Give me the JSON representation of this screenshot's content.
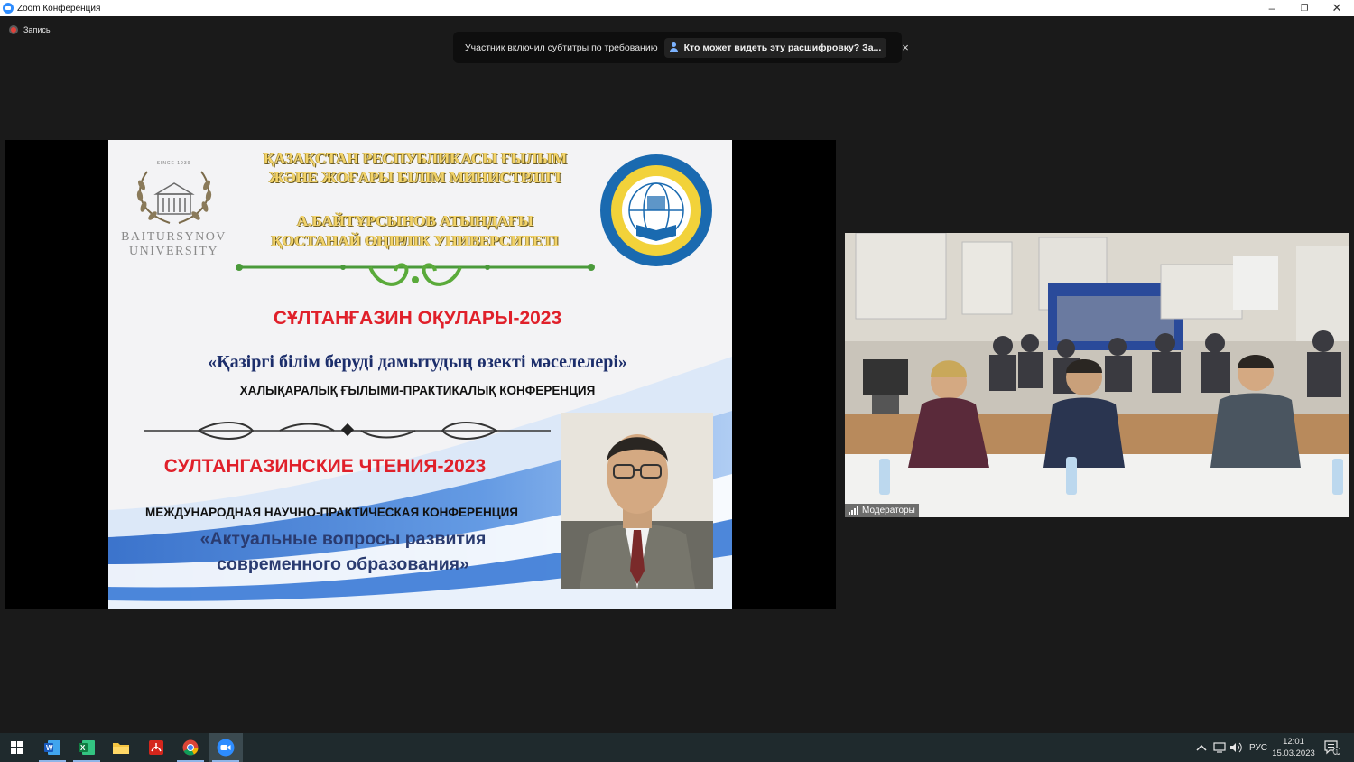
{
  "window": {
    "title": "Zoom Конференция",
    "controls": {
      "minimize": "–",
      "restore": "❐",
      "close": "✕"
    }
  },
  "recording": {
    "label": "Запись"
  },
  "notification": {
    "message": "Участник включил субтитры по требованию",
    "link": "Кто может видеть эту расшифровку? За...",
    "close": "×"
  },
  "slide": {
    "university_since": "SINCE 1939",
    "university_line1": "BAITURSYNOV",
    "university_line2": "UNIVERSITY",
    "ministry_line1": "ҚАЗАҚСТАН РЕСПУБЛИКАСЫ ҒЫЛЫМ",
    "ministry_line2": "ЖӘНЕ ЖОҒАРЫ БІЛІМ МИНИСТРЛІГІ",
    "uni_line1": "А.БАЙТҰРСЫНОВ АТЫНДАҒЫ",
    "uni_line2": "ҚОСТАНАЙ ӨҢІРЛІК УНИВЕРСИТЕТІ",
    "title_kz": "СҰЛТАНҒАЗИН ОҚУЛАРЫ-2023",
    "subtitle_kz": "«Қазіргі білім беруді дамытудың өзекті мәселелері»",
    "conf_kz": "ХАЛЫҚАРАЛЫҚ ҒЫЛЫМИ-ПРАКТИКАЛЫҚ КОНФЕРЕНЦИЯ",
    "title_ru": "СУЛТАНГАЗИНСКИЕ ЧТЕНИЯ-2023",
    "conf_ru": "МЕЖДУНАРОДНАЯ НАУЧНО-ПРАКТИЧЕСКАЯ КОНФЕРЕНЦИЯ",
    "subtitle_ru_line1": "«Актуальные вопросы развития",
    "subtitle_ru_line2": "современного образования»"
  },
  "video": {
    "participant_name": "Модераторы"
  },
  "taskbar": {
    "apps": [
      "start-icon",
      "word-icon",
      "excel-icon",
      "file-explorer-icon",
      "acrobat-icon",
      "chrome-icon",
      "zoom-icon"
    ],
    "language": "РУС",
    "time": "12:01",
    "date": "15.03.2023",
    "notifications_count": "1"
  },
  "colors": {
    "accent_blue": "#2d8cff",
    "slide_red": "#e0202a",
    "slide_gold": "#f2d36b",
    "taskbar": "#1f2a2d"
  }
}
